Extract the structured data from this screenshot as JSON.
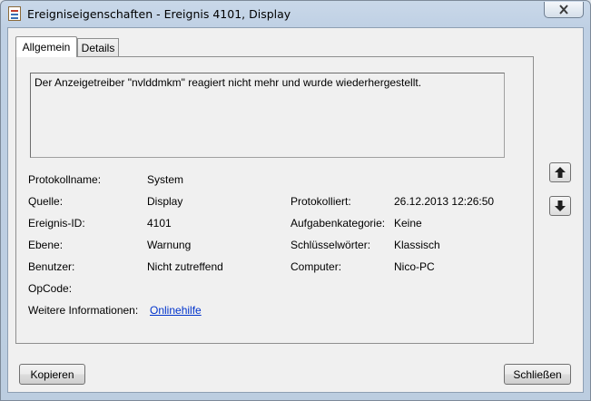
{
  "window": {
    "title": "Ereigniseigenschaften - Ereignis 4101, Display",
    "icon": "event-viewer-icon",
    "close_icon": "close-icon"
  },
  "tabs": [
    {
      "label": "Allgemein",
      "active": true
    },
    {
      "label": "Details",
      "active": false
    }
  ],
  "message": "Der Anzeigetreiber \"nvlddmkm\" reagiert nicht mehr und wurde wiederhergestellt.",
  "fields": {
    "protokollname": {
      "label": "Protokollname:",
      "value": "System"
    },
    "quelle": {
      "label": "Quelle:",
      "value": "Display"
    },
    "protokolliert": {
      "label": "Protokolliert:",
      "value": "26.12.2013 12:26:50"
    },
    "ereignis_id": {
      "label": "Ereignis-ID:",
      "value": "4101"
    },
    "aufgabenkategorie": {
      "label": "Aufgabenkategorie:",
      "value": "Keine"
    },
    "ebene": {
      "label": "Ebene:",
      "value": "Warnung"
    },
    "schluesselwoerter": {
      "label": "Schlüsselwörter:",
      "value": "Klassisch"
    },
    "benutzer": {
      "label": "Benutzer:",
      "value": "Nicht zutreffend"
    },
    "computer": {
      "label": "Computer:",
      "value": "Nico-PC"
    },
    "opcode": {
      "label": "OpCode:",
      "value": ""
    },
    "weitere": {
      "label": "Weitere Informationen:",
      "link": "Onlinehilfe"
    }
  },
  "nav": {
    "up_icon": "arrow-up-icon",
    "down_icon": "arrow-down-icon"
  },
  "buttons": {
    "copy": "Kopieren",
    "close": "Schließen"
  }
}
